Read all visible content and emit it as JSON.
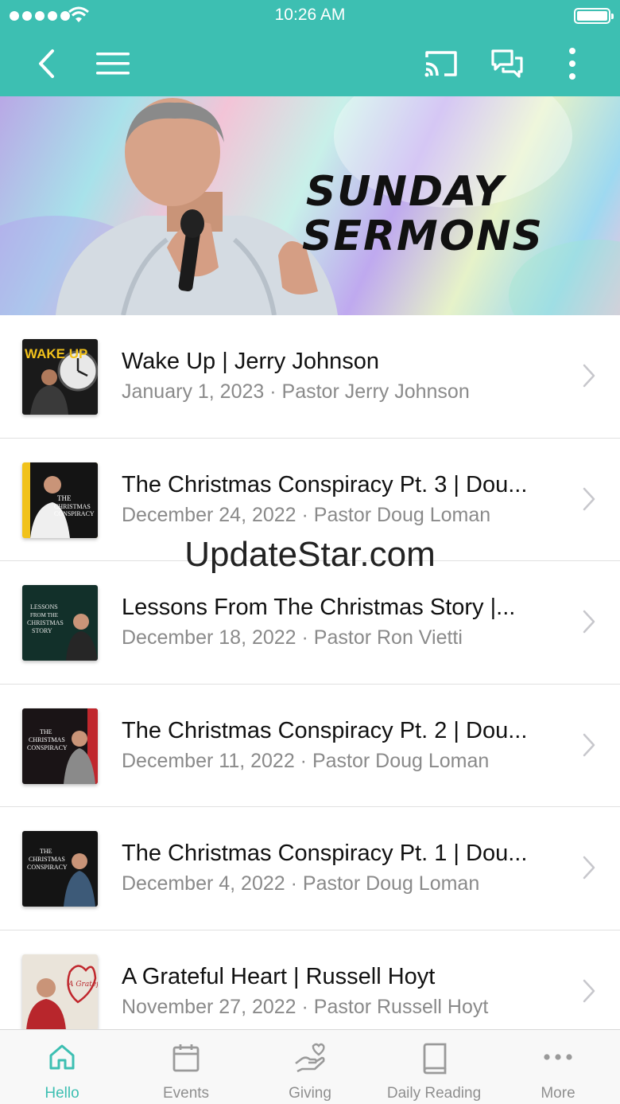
{
  "status_bar": {
    "time": "10:26 AM"
  },
  "header": {
    "back_icon": "chevron-left-icon",
    "menu_icon": "hamburger-icon",
    "cast_icon": "cast-icon",
    "chat_icon": "chat-bubbles-icon",
    "more_icon": "vertical-dots-icon",
    "accent_color": "#3dbfb2"
  },
  "banner": {
    "title_line1": "SUNDAY",
    "title_line2": "SERMONS"
  },
  "sermons": [
    {
      "title": "Wake Up | Jerry Johnson",
      "subtitle": "January 1, 2023 · Pastor Jerry Johnson",
      "thumb_text": "WAKE UP"
    },
    {
      "title": "The Christmas Conspiracy Pt. 3 | Dou...",
      "subtitle": "December 24, 2022 · Pastor Doug Loman",
      "thumb_text": "THE CHRISTMAS CONSPIRACY"
    },
    {
      "title": "Lessons From The Christmas Story |...",
      "subtitle": "December 18, 2022 · Pastor Ron Vietti",
      "thumb_text": "LESSONS FROM THE CHRISTMAS STORY"
    },
    {
      "title": "The Christmas Conspiracy Pt. 2 | Dou...",
      "subtitle": "December 11, 2022 · Pastor Doug Loman",
      "thumb_text": "THE CHRISTMAS CONSPIRACY"
    },
    {
      "title": "The Christmas Conspiracy Pt. 1 | Dou...",
      "subtitle": "December 4, 2022 · Pastor Doug Loman",
      "thumb_text": "THE CHRISTMAS CONSPIRACY"
    },
    {
      "title": "A Grateful Heart | Russell Hoyt",
      "subtitle": "November 27, 2022 · Pastor Russell Hoyt",
      "thumb_text": "A Grateful Heart"
    }
  ],
  "watermark": "UpdateStar.com",
  "tabs": [
    {
      "label": "Hello",
      "icon": "home-icon",
      "active": true
    },
    {
      "label": "Events",
      "icon": "calendar-icon",
      "active": false
    },
    {
      "label": "Giving",
      "icon": "giving-hand-icon",
      "active": false
    },
    {
      "label": "Daily Reading",
      "icon": "book-icon",
      "active": false
    },
    {
      "label": "More",
      "icon": "horizontal-dots-icon",
      "active": false
    }
  ]
}
